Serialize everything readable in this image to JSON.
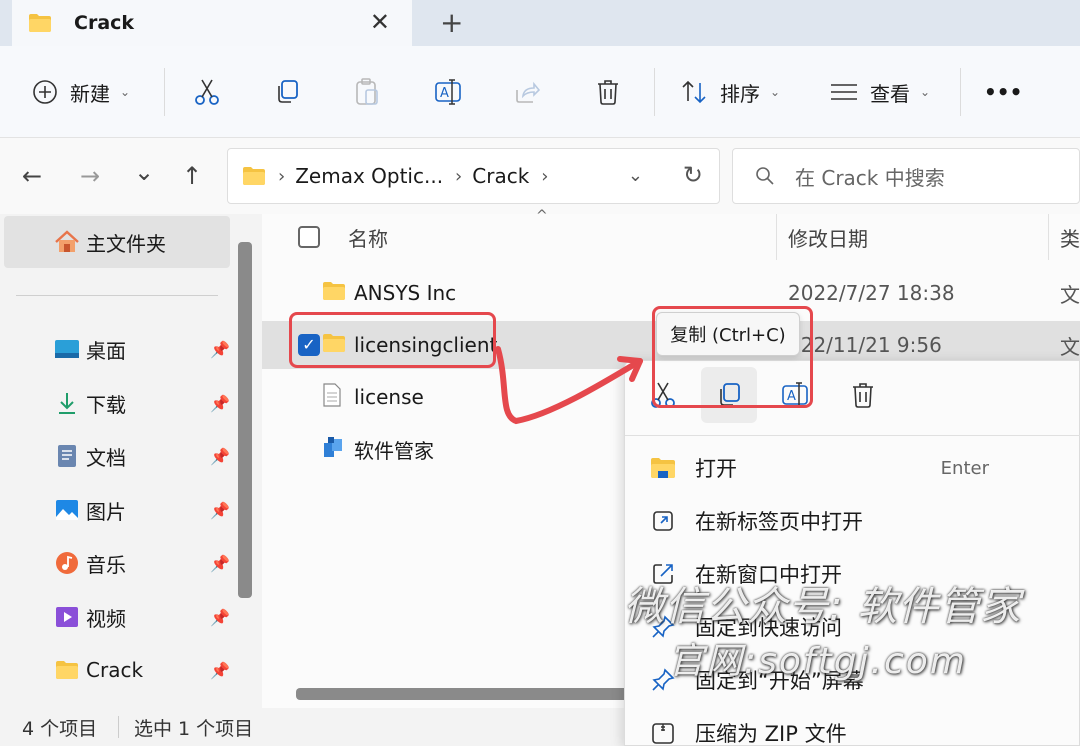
{
  "tab": {
    "title": "Crack",
    "close": "✕",
    "new_tab": "+"
  },
  "toolbar": {
    "new_label": "新建",
    "sort_label": "排序",
    "view_label": "查看",
    "more": "•••"
  },
  "nav": {
    "back": "←",
    "forward": "→",
    "recent": "⌄",
    "up": "↑",
    "breadcrumbs": [
      "Zemax Optic...",
      "Crack"
    ],
    "search_placeholder": "在 Crack 中搜索"
  },
  "sidebar": {
    "home": "主文件夹",
    "items": [
      {
        "label": "桌面",
        "icon": "desktop-icon"
      },
      {
        "label": "下载",
        "icon": "download-icon"
      },
      {
        "label": "文档",
        "icon": "document-icon"
      },
      {
        "label": "图片",
        "icon": "picture-icon"
      },
      {
        "label": "音乐",
        "icon": "music-icon"
      },
      {
        "label": "视频",
        "icon": "video-icon"
      },
      {
        "label": "Crack",
        "icon": "folder-icon"
      }
    ]
  },
  "columns": {
    "name": "名称",
    "modified": "修改日期",
    "type": "类"
  },
  "files": [
    {
      "name": "ANSYS Inc",
      "modified": "2022/7/27 18:38",
      "type": "文",
      "icon": "folder-icon"
    },
    {
      "name": "licensingclient",
      "modified": "022/11/21 9:56",
      "type": "文",
      "icon": "folder-icon",
      "selected": true
    },
    {
      "name": "license",
      "modified": "",
      "type": "",
      "icon": "file-icon"
    },
    {
      "name": "软件管家",
      "modified": "",
      "type": "",
      "icon": "app-icon"
    }
  ],
  "tooltip": "复制 (Ctrl+C)",
  "context_menu": {
    "items": [
      {
        "label": "打开",
        "shortcut": "Enter",
        "icon": "folder-open-icon"
      },
      {
        "label": "在新标签页中打开",
        "icon": "new-tab-icon"
      },
      {
        "label": "在新窗口中打开",
        "icon": "new-window-icon"
      },
      {
        "label": "固定到快速访问",
        "icon": "pin-icon"
      },
      {
        "label": "固定到“开始”屏幕",
        "icon": "pin-icon"
      },
      {
        "label": "压缩为 ZIP 文件",
        "icon": "zip-icon"
      }
    ]
  },
  "status": {
    "count": "4 个项目",
    "selected": "选中 1 个项目"
  },
  "watermark": {
    "line1": "微信公众号: 软件管家",
    "line2": "官网:softgj.com"
  },
  "colors": {
    "accent": "#1863c4",
    "highlight": "#e5484d",
    "folder": "#f5c342"
  }
}
